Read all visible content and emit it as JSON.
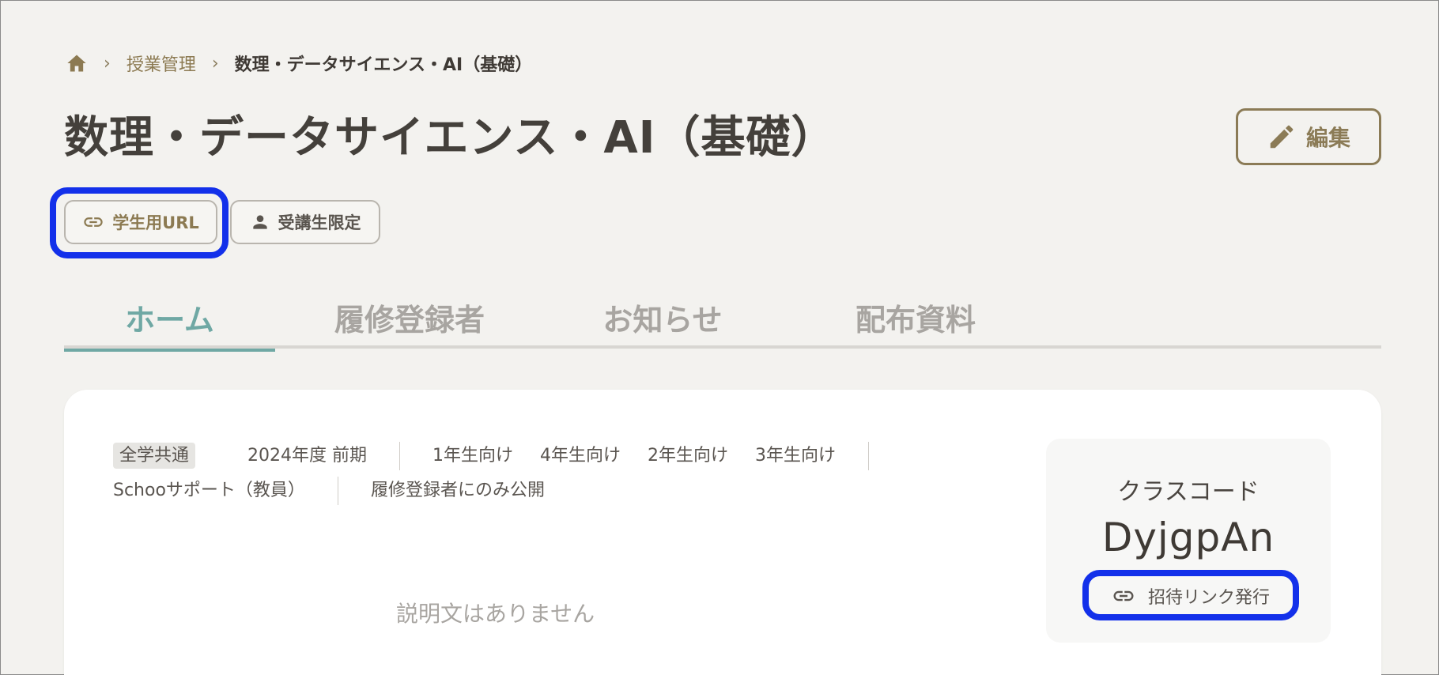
{
  "breadcrumb": {
    "home_icon": "home-icon",
    "items": [
      "授業管理",
      "数理・データサイエンス・AI（基礎）"
    ]
  },
  "page": {
    "title": "数理・データサイエンス・AI（基礎）",
    "edit_label": "編集"
  },
  "chips": {
    "student_url": "学生用URL",
    "enrolled_only": "受講生限定"
  },
  "tabs": [
    {
      "label": "ホーム",
      "active": true
    },
    {
      "label": "履修登録者",
      "active": false
    },
    {
      "label": "お知らせ",
      "active": false
    },
    {
      "label": "配布資料",
      "active": false
    }
  ],
  "course": {
    "category": "全学共通",
    "term": "2024年度 前期",
    "grades": [
      "1年生向け",
      "4年生向け",
      "2年生向け",
      "3年生向け"
    ],
    "teacher": "Schooサポート（教員）",
    "visibility": "履修登録者にのみ公開",
    "description_empty": "説明文はありません"
  },
  "class_code": {
    "label": "クラスコード",
    "code": "DyjgpAn",
    "invite_label": "招待リンク発行"
  },
  "colors": {
    "accent": "#6fa8a4",
    "brand_brown": "#8b7b56",
    "highlight": "#1330ea",
    "background": "#f3f2ef"
  }
}
